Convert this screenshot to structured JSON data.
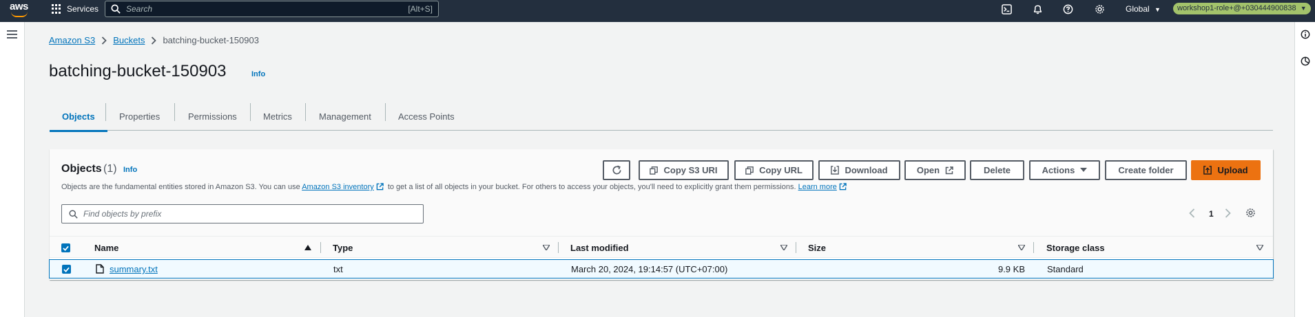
{
  "topnav": {
    "logo_text": "aws",
    "services_label": "Services",
    "search_placeholder": "Search",
    "search_shortcut": "[Alt+S]",
    "region_label": "Global",
    "account_label": "workshop1-role+@+030444900838"
  },
  "breadcrumb": {
    "items": [
      "Amazon S3",
      "Buckets"
    ],
    "current": "batching-bucket-150903"
  },
  "page": {
    "title": "batching-bucket-150903",
    "info_label": "Info"
  },
  "tabs": [
    {
      "label": "Objects",
      "active": true
    },
    {
      "label": "Properties",
      "active": false
    },
    {
      "label": "Permissions",
      "active": false
    },
    {
      "label": "Metrics",
      "active": false
    },
    {
      "label": "Management",
      "active": false
    },
    {
      "label": "Access Points",
      "active": false
    }
  ],
  "objects_panel": {
    "title": "Objects",
    "count": "(1)",
    "info_label": "Info",
    "description_before": "Objects are the fundamental entities stored in Amazon S3. You can use",
    "inventory_link": "Amazon S3 inventory",
    "description_middle": "to get a list of all objects in your bucket. For others to access your objects, you'll need to explicitly grant them permissions.",
    "learn_more_link": "Learn more",
    "buttons": {
      "copy_uri": "Copy S3 URI",
      "copy_url": "Copy URL",
      "download": "Download",
      "open": "Open",
      "delete": "Delete",
      "actions": "Actions",
      "create_folder": "Create folder",
      "upload": "Upload"
    },
    "find_placeholder": "Find objects by prefix",
    "page_number": "1"
  },
  "table": {
    "columns": [
      "Name",
      "Type",
      "Last modified",
      "Size",
      "Storage class"
    ],
    "rows": [
      {
        "name": "summary.txt",
        "type": "txt",
        "last_modified": "March 20, 2024, 19:14:57 (UTC+07:00)",
        "size": "9.9 KB",
        "storage_class": "Standard",
        "selected": true
      }
    ]
  },
  "colors": {
    "nav_bg": "#232f3e",
    "link": "#0073bb",
    "primary_button": "#ec7211",
    "account_badge": "#a3c36b"
  }
}
